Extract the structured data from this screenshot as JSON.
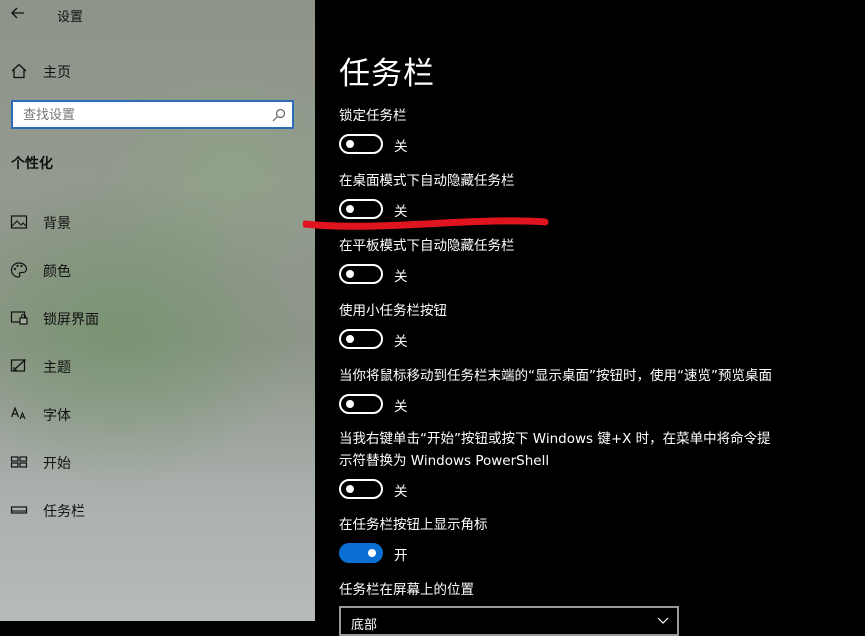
{
  "window": {
    "title": "设置"
  },
  "sidebar": {
    "home_label": "主页",
    "search_placeholder": "查找设置",
    "section_heading": "个性化",
    "items": [
      {
        "label": "背景",
        "icon": "image-icon"
      },
      {
        "label": "颜色",
        "icon": "palette-icon"
      },
      {
        "label": "锁屏界面",
        "icon": "lock-screen-icon"
      },
      {
        "label": "主题",
        "icon": "theme-icon"
      },
      {
        "label": "字体",
        "icon": "font-icon"
      },
      {
        "label": "开始",
        "icon": "start-icon"
      },
      {
        "label": "任务栏",
        "icon": "taskbar-icon"
      }
    ]
  },
  "main": {
    "title": "任务栏",
    "settings": [
      {
        "label": "锁定任务栏",
        "state_text": "关",
        "on": false
      },
      {
        "label": "在桌面模式下自动隐藏任务栏",
        "state_text": "关",
        "on": false
      },
      {
        "label": "在平板模式下自动隐藏任务栏",
        "state_text": "关",
        "on": false
      },
      {
        "label": "使用小任务栏按钮",
        "state_text": "关",
        "on": false
      },
      {
        "label": "当你将鼠标移动到任务栏末端的“显示桌面”按钮时，使用“速览”预览桌面",
        "state_text": "关",
        "on": false
      },
      {
        "label": "当我右键单击“开始”按钮或按下 Windows 键+X 时，在菜单中将命令提示符替换为 Windows PowerShell",
        "state_text": "关",
        "on": false
      },
      {
        "label": "在任务栏按钮上显示角标",
        "state_text": "开",
        "on": true
      }
    ],
    "position_label": "任务栏在屏幕上的位置",
    "position_value": "底部"
  },
  "colors": {
    "accent": "#0a6fd3",
    "annotation_red": "#e0141e"
  }
}
